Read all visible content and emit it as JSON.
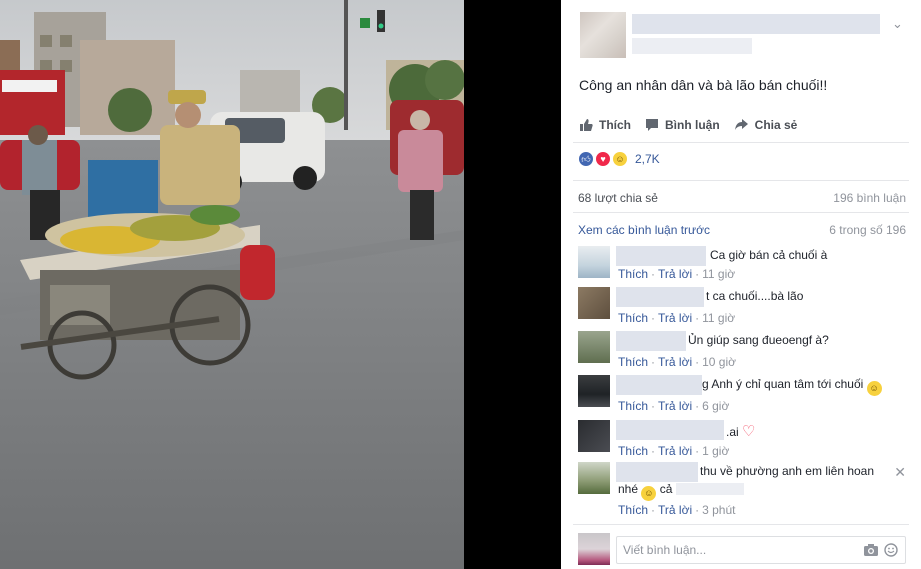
{
  "post": {
    "text": "Công an nhân dân và bà lão bán chuối!!",
    "actions": {
      "like": "Thích",
      "comment": "Bình luận",
      "share": "Chia sẻ"
    },
    "reaction_count": "2,7K",
    "share_count": "68 lượt chia sẻ",
    "comment_total": "196 bình luận",
    "prev_comments": "Xem các bình luận trước",
    "comment_range": "6 trong số 196"
  },
  "comments": [
    {
      "text": "Ca giờ bán cả chuối à",
      "like": "Thích",
      "reply": "Trả lời",
      "time": "11 giờ"
    },
    {
      "text": "t ca chuối....bà lão",
      "like": "Thích",
      "reply": "Trả lời",
      "time": "11 giờ"
    },
    {
      "text": "Ủn giúp sang đueoengf à?",
      "like": "Thích",
      "reply": "Trả lời",
      "time": "10 giờ"
    },
    {
      "text": "g Anh ý chỉ quan tâm tới chuối",
      "like": "Thích",
      "reply": "Trả lời",
      "time": "6 giờ"
    },
    {
      "text": ".ai",
      "like": "Thích",
      "reply": "Trả lời",
      "time": "1 giờ"
    },
    {
      "text": "thu về phường anh em liên hoan",
      "text2": "nhé",
      "text3": "cả",
      "like": "Thích",
      "reply": "Trả lời",
      "time": "3 phút"
    }
  ],
  "composer": {
    "placeholder": "Viết bình luận..."
  },
  "colors": {
    "link": "#365899",
    "muted": "#90949c",
    "like_blue": "#4267b2",
    "love_red": "#f0284a",
    "haha_yellow": "#f7d13e"
  },
  "icons": [
    "chevron-down-icon",
    "like-icon",
    "comment-icon",
    "share-icon",
    "camera-icon",
    "smiley-icon",
    "close-icon",
    "heart-icon"
  ]
}
